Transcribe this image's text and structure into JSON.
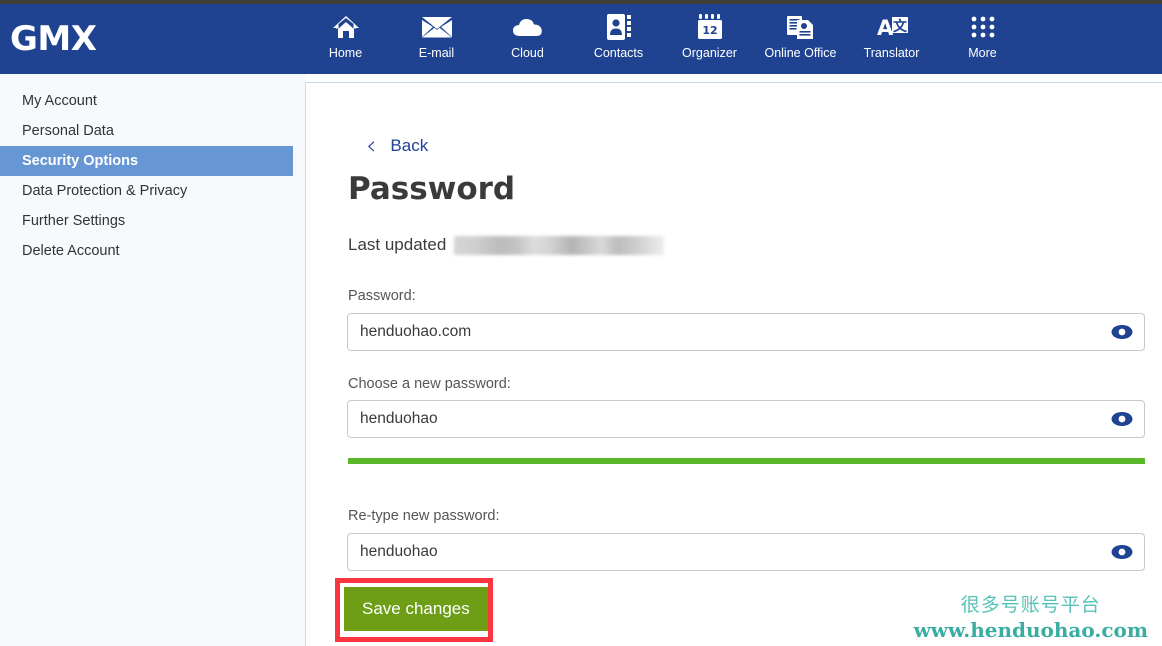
{
  "brand": {
    "name": "GMX"
  },
  "nav": {
    "items": [
      {
        "label": "Home",
        "icon": "home-icon"
      },
      {
        "label": "E-mail",
        "icon": "envelope-icon"
      },
      {
        "label": "Cloud",
        "icon": "cloud-icon"
      },
      {
        "label": "Contacts",
        "icon": "contacts-book-icon"
      },
      {
        "label": "Organizer",
        "icon": "calendar-icon",
        "day": "12"
      },
      {
        "label": "Online Office",
        "icon": "documents-icon"
      },
      {
        "label": "Translator",
        "icon": "translate-icon"
      },
      {
        "label": "More",
        "icon": "grid-dots-icon"
      }
    ]
  },
  "sidebar": {
    "items": [
      {
        "label": "My Account",
        "active": false
      },
      {
        "label": "Personal Data",
        "active": false
      },
      {
        "label": "Security Options",
        "active": true
      },
      {
        "label": "Data Protection & Privacy",
        "active": false
      },
      {
        "label": "Further Settings",
        "active": false
      },
      {
        "label": "Delete Account",
        "active": false
      }
    ]
  },
  "main": {
    "back_label": "Back",
    "title": "Password",
    "last_updated_label": "Last updated",
    "last_updated_value": "",
    "fields": [
      {
        "label": "Password:",
        "value": "henduohao.com",
        "placeholder": ""
      },
      {
        "label": "Choose a new password:",
        "value": "henduohao",
        "placeholder": ""
      },
      {
        "label": "Re-type new password:",
        "value": "henduohao",
        "placeholder": ""
      }
    ],
    "strength": {
      "level": "strong",
      "percent": 100,
      "color": "#5cb82b"
    },
    "save_label": "Save changes"
  },
  "annotation": {
    "highlight_color": "#fb3640"
  },
  "watermark": {
    "cn": "很多号账号平台",
    "url": "www.henduohao.com",
    "color": "#3aada2"
  },
  "colors": {
    "header_blue": "#1f4391",
    "sidebar_active": "#6796d4",
    "save_green": "#6d9e16",
    "link_blue": "#20409a"
  }
}
